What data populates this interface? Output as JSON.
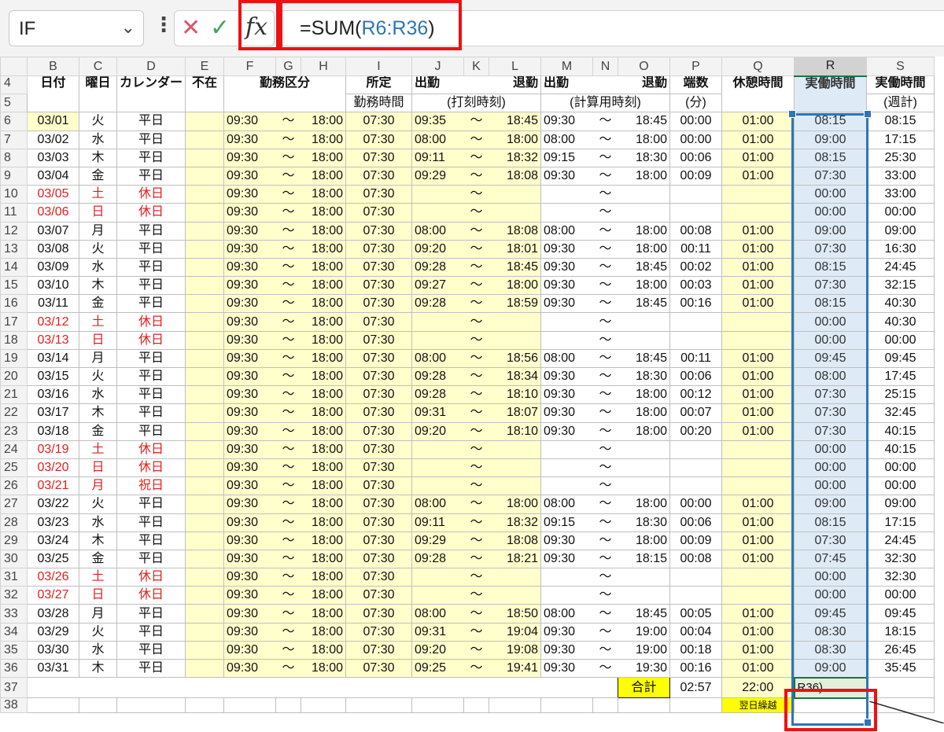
{
  "formula_bar": {
    "name_box": "IF",
    "cancel_icon": "✕",
    "enter_icon": "✓",
    "fx_label": "fx",
    "formula_prefix": "=SUM(",
    "formula_ref": "R6:R36",
    "formula_suffix": ")"
  },
  "columns": [
    "B",
    "C",
    "D",
    "E",
    "F",
    "G",
    "H",
    "I",
    "J",
    "K",
    "L",
    "M",
    "N",
    "O",
    "P",
    "Q",
    "R",
    "S"
  ],
  "headers": {
    "date": "日付",
    "weekday": "曜日",
    "calendar": "カレンダー",
    "absent": "不在",
    "work_type": "勤務区分",
    "scheduled_1": "所定",
    "scheduled_2": "勤務時間",
    "stamp_in": "出勤",
    "stamp_out": "退勤",
    "stamp_label": "(打刻時刻)",
    "calc_in": "出勤",
    "calc_out": "退勤",
    "calc_label": "(計算用時刻)",
    "fraction_1": "端数",
    "fraction_2": "(分)",
    "break": "休憩時間",
    "actual": "実働時間",
    "weekly_1": "実働時間",
    "weekly_2": "(週計)"
  },
  "row_numbers": {
    "header_1": "4",
    "header_2": "5",
    "total": "37",
    "partial": "38"
  },
  "rows": [
    {
      "n": "6",
      "date": "03/01",
      "dow": "火",
      "cal": "平日",
      "off": false,
      "ws": "09:30",
      "we": "18:00",
      "sched": "07:30",
      "si": "09:35",
      "so": "18:45",
      "ci": "09:30",
      "co": "18:45",
      "frac": "00:00",
      "brk": "01:00",
      "act": "08:15",
      "wk": "08:15"
    },
    {
      "n": "7",
      "date": "03/02",
      "dow": "水",
      "cal": "平日",
      "off": false,
      "ws": "09:30",
      "we": "18:00",
      "sched": "07:30",
      "si": "08:00",
      "so": "18:00",
      "ci": "08:00",
      "co": "18:00",
      "frac": "00:00",
      "brk": "01:00",
      "act": "09:00",
      "wk": "17:15"
    },
    {
      "n": "8",
      "date": "03/03",
      "dow": "木",
      "cal": "平日",
      "off": false,
      "ws": "09:30",
      "we": "18:00",
      "sched": "07:30",
      "si": "09:11",
      "so": "18:32",
      "ci": "09:15",
      "co": "18:30",
      "frac": "00:06",
      "brk": "01:00",
      "act": "08:15",
      "wk": "25:30"
    },
    {
      "n": "9",
      "date": "03/04",
      "dow": "金",
      "cal": "平日",
      "off": false,
      "ws": "09:30",
      "we": "18:00",
      "sched": "07:30",
      "si": "09:29",
      "so": "18:08",
      "ci": "09:30",
      "co": "18:00",
      "frac": "00:09",
      "brk": "01:00",
      "act": "07:30",
      "wk": "33:00"
    },
    {
      "n": "10",
      "date": "03/05",
      "dow": "土",
      "cal": "休日",
      "off": true,
      "ws": "09:30",
      "we": "18:00",
      "sched": "07:30",
      "si": "",
      "so": "",
      "ci": "",
      "co": "",
      "frac": "",
      "brk": "",
      "act": "00:00",
      "wk": "33:00"
    },
    {
      "n": "11",
      "date": "03/06",
      "dow": "日",
      "cal": "休日",
      "off": true,
      "ws": "09:30",
      "we": "18:00",
      "sched": "07:30",
      "si": "",
      "so": "",
      "ci": "",
      "co": "",
      "frac": "",
      "brk": "",
      "act": "00:00",
      "wk": "00:00"
    },
    {
      "n": "12",
      "date": "03/07",
      "dow": "月",
      "cal": "平日",
      "off": false,
      "ws": "09:30",
      "we": "18:00",
      "sched": "07:30",
      "si": "08:00",
      "so": "18:08",
      "ci": "08:00",
      "co": "18:00",
      "frac": "00:08",
      "brk": "01:00",
      "act": "09:00",
      "wk": "09:00"
    },
    {
      "n": "13",
      "date": "03/08",
      "dow": "火",
      "cal": "平日",
      "off": false,
      "ws": "09:30",
      "we": "18:00",
      "sched": "07:30",
      "si": "09:20",
      "so": "18:01",
      "ci": "09:30",
      "co": "18:00",
      "frac": "00:11",
      "brk": "01:00",
      "act": "07:30",
      "wk": "16:30"
    },
    {
      "n": "14",
      "date": "03/09",
      "dow": "水",
      "cal": "平日",
      "off": false,
      "ws": "09:30",
      "we": "18:00",
      "sched": "07:30",
      "si": "09:28",
      "so": "18:45",
      "ci": "09:30",
      "co": "18:45",
      "frac": "00:02",
      "brk": "01:00",
      "act": "08:15",
      "wk": "24:45"
    },
    {
      "n": "15",
      "date": "03/10",
      "dow": "木",
      "cal": "平日",
      "off": false,
      "ws": "09:30",
      "we": "18:00",
      "sched": "07:30",
      "si": "09:27",
      "so": "18:00",
      "ci": "09:30",
      "co": "18:00",
      "frac": "00:03",
      "brk": "01:00",
      "act": "07:30",
      "wk": "32:15"
    },
    {
      "n": "16",
      "date": "03/11",
      "dow": "金",
      "cal": "平日",
      "off": false,
      "ws": "09:30",
      "we": "18:00",
      "sched": "07:30",
      "si": "09:28",
      "so": "18:59",
      "ci": "09:30",
      "co": "18:45",
      "frac": "00:16",
      "brk": "01:00",
      "act": "08:15",
      "wk": "40:30"
    },
    {
      "n": "17",
      "date": "03/12",
      "dow": "土",
      "cal": "休日",
      "off": true,
      "ws": "09:30",
      "we": "18:00",
      "sched": "07:30",
      "si": "",
      "so": "",
      "ci": "",
      "co": "",
      "frac": "",
      "brk": "",
      "act": "00:00",
      "wk": "40:30"
    },
    {
      "n": "18",
      "date": "03/13",
      "dow": "日",
      "cal": "休日",
      "off": true,
      "ws": "09:30",
      "we": "18:00",
      "sched": "07:30",
      "si": "",
      "so": "",
      "ci": "",
      "co": "",
      "frac": "",
      "brk": "",
      "act": "00:00",
      "wk": "00:00"
    },
    {
      "n": "19",
      "date": "03/14",
      "dow": "月",
      "cal": "平日",
      "off": false,
      "ws": "09:30",
      "we": "18:00",
      "sched": "07:30",
      "si": "08:00",
      "so": "18:56",
      "ci": "08:00",
      "co": "18:45",
      "frac": "00:11",
      "brk": "01:00",
      "act": "09:45",
      "wk": "09:45"
    },
    {
      "n": "20",
      "date": "03/15",
      "dow": "火",
      "cal": "平日",
      "off": false,
      "ws": "09:30",
      "we": "18:00",
      "sched": "07:30",
      "si": "09:28",
      "so": "18:34",
      "ci": "09:30",
      "co": "18:30",
      "frac": "00:06",
      "brk": "01:00",
      "act": "08:00",
      "wk": "17:45"
    },
    {
      "n": "21",
      "date": "03/16",
      "dow": "水",
      "cal": "平日",
      "off": false,
      "ws": "09:30",
      "we": "18:00",
      "sched": "07:30",
      "si": "09:28",
      "so": "18:10",
      "ci": "09:30",
      "co": "18:00",
      "frac": "00:12",
      "brk": "01:00",
      "act": "07:30",
      "wk": "25:15"
    },
    {
      "n": "22",
      "date": "03/17",
      "dow": "木",
      "cal": "平日",
      "off": false,
      "ws": "09:30",
      "we": "18:00",
      "sched": "07:30",
      "si": "09:31",
      "so": "18:07",
      "ci": "09:30",
      "co": "18:00",
      "frac": "00:07",
      "brk": "01:00",
      "act": "07:30",
      "wk": "32:45"
    },
    {
      "n": "23",
      "date": "03/18",
      "dow": "金",
      "cal": "平日",
      "off": false,
      "ws": "09:30",
      "we": "18:00",
      "sched": "07:30",
      "si": "09:20",
      "so": "18:10",
      "ci": "09:30",
      "co": "18:00",
      "frac": "00:20",
      "brk": "01:00",
      "act": "07:30",
      "wk": "40:15"
    },
    {
      "n": "24",
      "date": "03/19",
      "dow": "土",
      "cal": "休日",
      "off": true,
      "ws": "09:30",
      "we": "18:00",
      "sched": "07:30",
      "si": "",
      "so": "",
      "ci": "",
      "co": "",
      "frac": "",
      "brk": "",
      "act": "00:00",
      "wk": "40:15"
    },
    {
      "n": "25",
      "date": "03/20",
      "dow": "日",
      "cal": "休日",
      "off": true,
      "ws": "09:30",
      "we": "18:00",
      "sched": "07:30",
      "si": "",
      "so": "",
      "ci": "",
      "co": "",
      "frac": "",
      "brk": "",
      "act": "00:00",
      "wk": "00:00"
    },
    {
      "n": "26",
      "date": "03/21",
      "dow": "月",
      "cal": "祝日",
      "off": true,
      "ws": "09:30",
      "we": "18:00",
      "sched": "07:30",
      "si": "",
      "so": "",
      "ci": "",
      "co": "",
      "frac": "",
      "brk": "",
      "act": "00:00",
      "wk": "00:00"
    },
    {
      "n": "27",
      "date": "03/22",
      "dow": "火",
      "cal": "平日",
      "off": false,
      "ws": "09:30",
      "we": "18:00",
      "sched": "07:30",
      "si": "08:00",
      "so": "18:00",
      "ci": "08:00",
      "co": "18:00",
      "frac": "00:00",
      "brk": "01:00",
      "act": "09:00",
      "wk": "09:00"
    },
    {
      "n": "28",
      "date": "03/23",
      "dow": "水",
      "cal": "平日",
      "off": false,
      "ws": "09:30",
      "we": "18:00",
      "sched": "07:30",
      "si": "09:11",
      "so": "18:32",
      "ci": "09:15",
      "co": "18:30",
      "frac": "00:06",
      "brk": "01:00",
      "act": "08:15",
      "wk": "17:15"
    },
    {
      "n": "29",
      "date": "03/24",
      "dow": "木",
      "cal": "平日",
      "off": false,
      "ws": "09:30",
      "we": "18:00",
      "sched": "07:30",
      "si": "09:29",
      "so": "18:08",
      "ci": "09:30",
      "co": "18:00",
      "frac": "00:09",
      "brk": "01:00",
      "act": "07:30",
      "wk": "24:45"
    },
    {
      "n": "30",
      "date": "03/25",
      "dow": "金",
      "cal": "平日",
      "off": false,
      "ws": "09:30",
      "we": "18:00",
      "sched": "07:30",
      "si": "09:28",
      "so": "18:21",
      "ci": "09:30",
      "co": "18:15",
      "frac": "00:08",
      "brk": "01:00",
      "act": "07:45",
      "wk": "32:30"
    },
    {
      "n": "31",
      "date": "03/26",
      "dow": "土",
      "cal": "休日",
      "off": true,
      "ws": "09:30",
      "we": "18:00",
      "sched": "07:30",
      "si": "",
      "so": "",
      "ci": "",
      "co": "",
      "frac": "",
      "brk": "",
      "act": "00:00",
      "wk": "32:30"
    },
    {
      "n": "32",
      "date": "03/27",
      "dow": "日",
      "cal": "休日",
      "off": true,
      "ws": "09:30",
      "we": "18:00",
      "sched": "07:30",
      "si": "",
      "so": "",
      "ci": "",
      "co": "",
      "frac": "",
      "brk": "",
      "act": "00:00",
      "wk": "00:00"
    },
    {
      "n": "33",
      "date": "03/28",
      "dow": "月",
      "cal": "平日",
      "off": false,
      "ws": "09:30",
      "we": "18:00",
      "sched": "07:30",
      "si": "08:00",
      "so": "18:50",
      "ci": "08:00",
      "co": "18:45",
      "frac": "00:05",
      "brk": "01:00",
      "act": "09:45",
      "wk": "09:45"
    },
    {
      "n": "34",
      "date": "03/29",
      "dow": "火",
      "cal": "平日",
      "off": false,
      "ws": "09:30",
      "we": "18:00",
      "sched": "07:30",
      "si": "09:31",
      "so": "19:04",
      "ci": "09:30",
      "co": "19:00",
      "frac": "00:04",
      "brk": "01:00",
      "act": "08:30",
      "wk": "18:15"
    },
    {
      "n": "35",
      "date": "03/30",
      "dow": "水",
      "cal": "平日",
      "off": false,
      "ws": "09:30",
      "we": "18:00",
      "sched": "07:30",
      "si": "09:20",
      "so": "19:08",
      "ci": "09:30",
      "co": "19:00",
      "frac": "00:18",
      "brk": "01:00",
      "act": "08:30",
      "wk": "26:45"
    },
    {
      "n": "36",
      "date": "03/31",
      "dow": "木",
      "cal": "平日",
      "off": false,
      "ws": "09:30",
      "we": "18:00",
      "sched": "07:30",
      "si": "09:25",
      "so": "19:41",
      "ci": "09:30",
      "co": "19:30",
      "frac": "00:16",
      "brk": "01:00",
      "act": "09:00",
      "wk": "35:45"
    }
  ],
  "tilde": "〜",
  "totals": {
    "label": "合計",
    "fraction": "02:57",
    "break": "22:00",
    "editing": "R36)"
  },
  "partial_label": "翌日繰越"
}
